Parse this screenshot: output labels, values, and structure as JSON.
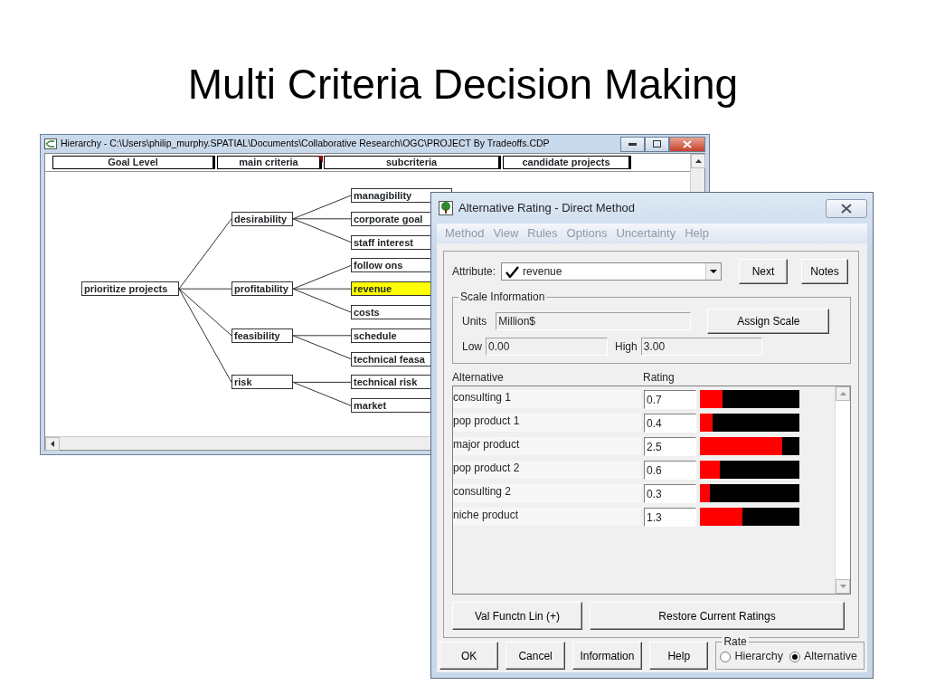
{
  "slide": {
    "title": "Multi Criteria Decision Making"
  },
  "hierarchy_window": {
    "title": "Hierarchy - C:\\Users\\philip_murphy.SPATIAL\\Documents\\Collaborative Research\\OGC\\PROJECT By Tradeoffs.CDP",
    "columns": [
      {
        "label": "Goal Level",
        "flagged": false
      },
      {
        "label": "main criteria",
        "flagged": true
      },
      {
        "label": "subcriteria",
        "flagged": false
      },
      {
        "label": "candidate projects",
        "flagged": false
      }
    ],
    "tree": {
      "label": "prioritize projects",
      "selected": false,
      "children": [
        {
          "label": "desirability",
          "selected": false,
          "children": [
            {
              "label": "managibility",
              "selected": false
            },
            {
              "label": "corporate goal",
              "selected": false
            },
            {
              "label": "staff interest",
              "selected": false
            }
          ]
        },
        {
          "label": "profitability",
          "selected": false,
          "children": [
            {
              "label": "follow ons",
              "selected": false
            },
            {
              "label": "revenue",
              "selected": true
            },
            {
              "label": "costs",
              "selected": false
            }
          ]
        },
        {
          "label": "feasibility",
          "selected": false,
          "children": [
            {
              "label": "schedule",
              "selected": false
            },
            {
              "label": "technical feasa",
              "selected": false
            }
          ]
        },
        {
          "label": "risk",
          "selected": false,
          "children": [
            {
              "label": "technical risk",
              "selected": false
            },
            {
              "label": "market",
              "selected": false
            }
          ]
        }
      ]
    }
  },
  "dialog": {
    "title": "Alternative Rating - Direct Method",
    "menu": [
      {
        "label": "Method",
        "disabled": true
      },
      {
        "label": "View",
        "disabled": true
      },
      {
        "label": "Rules",
        "disabled": true
      },
      {
        "label": "Options",
        "disabled": true
      },
      {
        "label": "Uncertainty",
        "disabled": true
      },
      {
        "label": "Help",
        "disabled": true
      }
    ],
    "attribute": {
      "label": "Attribute:",
      "value": "revenue",
      "checked": true
    },
    "top_buttons": [
      {
        "label": "Next"
      },
      {
        "label": "Notes"
      }
    ],
    "scale": {
      "legend": "Scale Information",
      "units_label": "Units",
      "units": "Million$",
      "assign_button": {
        "label": "Assign Scale"
      },
      "low_label": "Low",
      "low": "0.00",
      "high_label": "High",
      "high": "3.00"
    },
    "list": {
      "columns": [
        "Alternative",
        "Rating"
      ],
      "rows": [
        {
          "name": "consulting 1",
          "rating": "0.7",
          "level": 0.23
        },
        {
          "name": "pop product 1",
          "rating": "0.4",
          "level": 0.13
        },
        {
          "name": "major product",
          "rating": "2.5",
          "level": 0.83
        },
        {
          "name": "pop product 2",
          "rating": "0.6",
          "level": 0.2
        },
        {
          "name": "consulting 2",
          "rating": "0.3",
          "level": 0.1
        },
        {
          "name": "niche product",
          "rating": "1.3",
          "level": 0.43
        }
      ]
    },
    "list_buttons": [
      {
        "label": "Val Functn Lin (+)"
      },
      {
        "label": "Restore Current Ratings"
      }
    ],
    "bottom_buttons": [
      {
        "label": "OK"
      },
      {
        "label": "Cancel"
      },
      {
        "label": "Information"
      },
      {
        "label": "Help"
      }
    ],
    "rate": {
      "legend": "Rate",
      "options": [
        {
          "label": "Hierarchy",
          "selected": false
        },
        {
          "label": "Alternative",
          "selected": true
        }
      ]
    }
  }
}
